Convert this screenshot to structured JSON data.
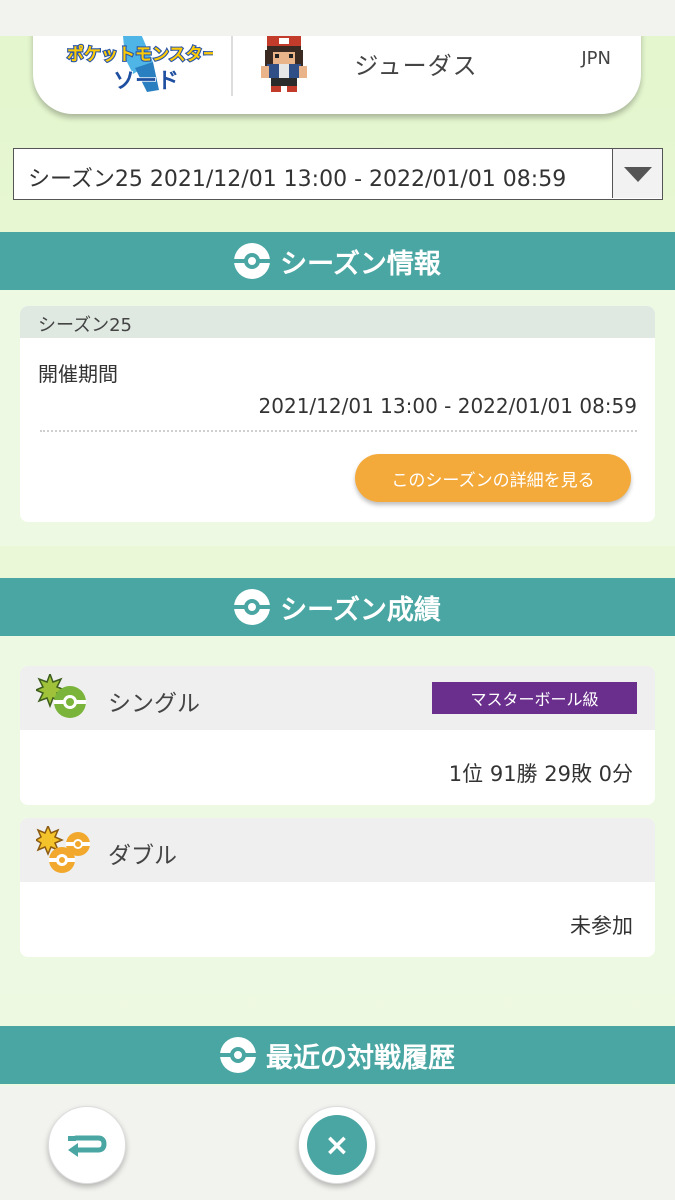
{
  "profile": {
    "game_logo_text": "ポケットモンスター ソード",
    "player_name": "ジューダス",
    "region": "JPN"
  },
  "season_select": {
    "selected": "シーズン25 2021/12/01 13:00 - 2022/01/01 08:59"
  },
  "season_info": {
    "heading": "シーズン情報",
    "card_title": "シーズン25",
    "period_label": "開催期間",
    "period_value": "2021/12/01 13:00 - 2022/01/01 08:59",
    "detail_button": "このシーズンの詳細を見る"
  },
  "season_results": {
    "heading": "シーズン成績",
    "items": [
      {
        "name": "シングル",
        "icon": "single-battle-icon",
        "badge": "マスターボール級",
        "value": "1位 91勝 29敗 0分"
      },
      {
        "name": "ダブル",
        "icon": "double-battle-icon",
        "value": "未参加"
      }
    ]
  },
  "recent_battles": {
    "heading": "最近の対戦履歴"
  },
  "nav": {
    "back_icon": "back-arrow-icon",
    "close_icon": "close-icon",
    "close_glyph": "×"
  },
  "colors": {
    "teal": "#4aa6a3",
    "orange_button": "#f4aa3a",
    "master_ball_purple": "#6a2e8c",
    "background_green": "#e3f6cd"
  }
}
